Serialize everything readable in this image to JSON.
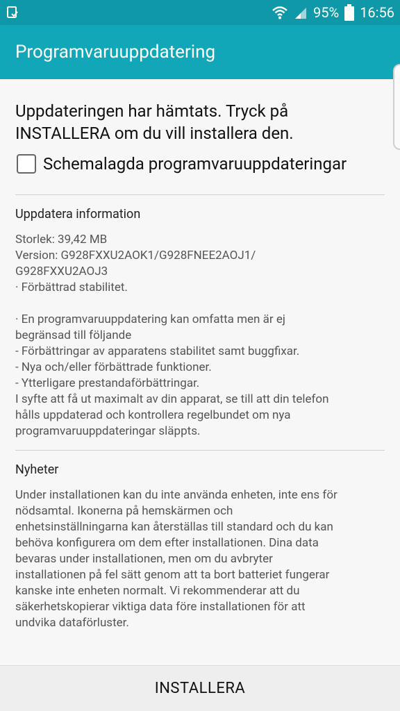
{
  "status_bar": {
    "battery_percent": "95%",
    "time": "16:56",
    "icons": [
      "notification-icon",
      "wifi-icon",
      "signal-icon",
      "battery-icon"
    ]
  },
  "app_bar": {
    "title": "Programvaruuppdatering"
  },
  "main": {
    "headline": "Uppdateringen har hämtats. Tryck på INSTALLERA om du vill installera den.",
    "schedule_checkbox": {
      "label": "Schemalagda programvaruuppdateringar",
      "checked": false
    },
    "update_info": {
      "title": "Uppdatera information",
      "text": "Storlek: 39,42 MB\nVersion: G928FXXU2AOK1/G928FNEE2AOJ1/\nG928FXXU2AOJ3\n· Förbättrad stabilitet.\n\n· En programvaruuppdatering kan omfatta men är ej\nbegränsad till följande\n - Förbättringar av apparatens stabilitet samt buggfixar.\n - Nya och/eller förbättrade funktioner.\n - Ytterligare prestandaförbättringar.\nI syfte att få ut maximalt av din apparat, se till att din telefon\nhålls uppdaterad och kontrollera regelbundet om nya\nprogramvaruuppdateringar släppts."
    },
    "news": {
      "title": "Nyheter",
      "text": "Under installationen kan du inte använda enheten, inte ens för\nnödsamtal. Ikonerna på hemskärmen och\nenhetsinställningarna kan återställas till standard och du kan\nbehöva konfigurera om dem efter installationen. Dina data\nbevaras under installationen, men om du avbryter\ninstallationen på fel sätt genom att ta bort batteriet fungerar\nkanske inte enheten normalt. Vi rekommenderar att du\nsäkerhetskopierar viktiga data före installationen för att\nundvika dataförluster."
    }
  },
  "bottom_bar": {
    "install_label": "INSTALLERA"
  },
  "colors": {
    "status_bar_bg": "#0f98a8",
    "app_bar_bg": "#11a6b8",
    "content_bg": "#f7f7f7",
    "bottom_bar_bg": "#eeeeee"
  }
}
